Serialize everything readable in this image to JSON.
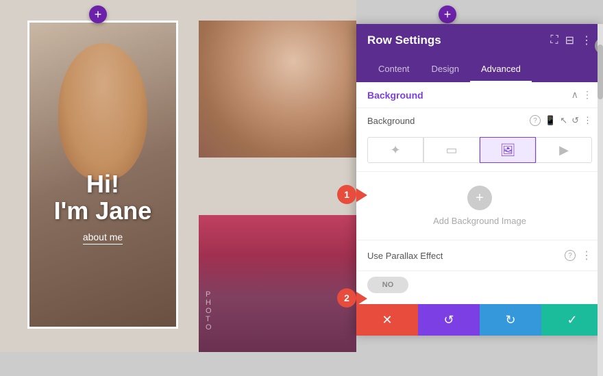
{
  "page": {
    "add_row_label": "+",
    "canvas_bg": "#d6d0c8"
  },
  "portrait": {
    "hi_text": "Hi!\nI'm Jane",
    "about_me": "about me"
  },
  "panel": {
    "title": "Row Settings",
    "tabs": [
      {
        "id": "content",
        "label": "Content"
      },
      {
        "id": "design",
        "label": "Design"
      },
      {
        "id": "advanced",
        "label": "Advanced"
      }
    ],
    "active_tab": "advanced",
    "section_title": "Background",
    "background_label": "Background",
    "bg_types": [
      {
        "icon": "✦",
        "label": "none",
        "active": false
      },
      {
        "icon": "▤",
        "label": "color",
        "active": false
      },
      {
        "icon": "🖼",
        "label": "image",
        "active": true
      },
      {
        "icon": "⬛",
        "label": "video",
        "active": false
      }
    ],
    "add_bg_label": "Add Background Image",
    "parallax_label": "Use Parallax Effect",
    "toggle_value": "NO",
    "actions": {
      "cancel": "✕",
      "undo": "↺",
      "redo": "↻",
      "save": "✓"
    }
  },
  "badges": {
    "one": "1",
    "two": "2"
  },
  "colors": {
    "purple": "#5b2d8e",
    "purple_light": "#7b3fe4",
    "red": "#e74c3c",
    "blue": "#3498db",
    "teal": "#1abc9c"
  }
}
